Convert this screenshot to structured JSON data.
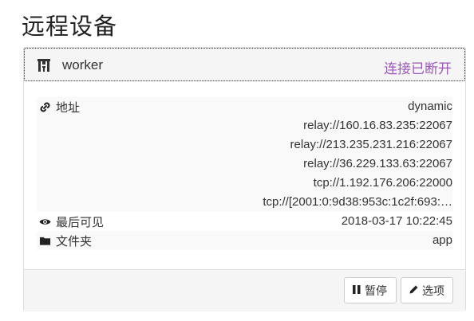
{
  "page": {
    "title": "远程设备"
  },
  "device": {
    "name": "worker",
    "status": "连接已断开",
    "status_color": "#9b59b6",
    "icon": "qrcode-icon"
  },
  "details": {
    "address": {
      "label": "地址",
      "icon": "link-icon",
      "values": [
        "dynamic",
        "relay://160.16.83.235:22067",
        "relay://213.235.231.216:22067",
        "relay://36.229.133.63:22067",
        "tcp://1.192.176.206:22000",
        "tcp://[2001:0:9d38:953c:1c2f:693:…"
      ]
    },
    "last_seen": {
      "label": "最后可见",
      "icon": "eye-icon",
      "value": "2018-03-17 10:22:45"
    },
    "folders": {
      "label": "文件夹",
      "icon": "folder-icon",
      "value": "app"
    }
  },
  "actions": {
    "pause": {
      "label": "暂停",
      "icon": "pause-icon"
    },
    "options": {
      "label": "选项",
      "icon": "pencil-icon"
    }
  }
}
